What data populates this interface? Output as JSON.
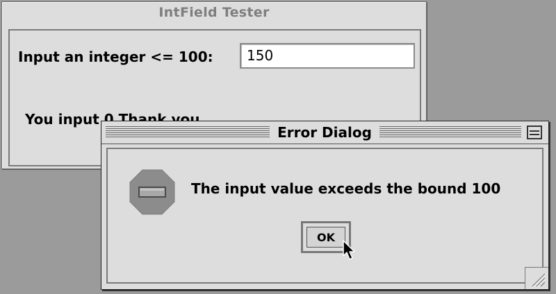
{
  "tester_window": {
    "title": "IntField Tester",
    "input_label": "Input an integer <= 100:",
    "input_value": "150",
    "result_text": "You input 0 Thank you"
  },
  "error_dialog": {
    "title": "Error Dialog",
    "message": "The input value exceeds the bound 100",
    "ok_label": "OK",
    "icon": "stop-icon"
  },
  "colors": {
    "desktop": "#9b9b9b",
    "window": "#dddddd",
    "stop_icon": "#8c8c8c"
  }
}
